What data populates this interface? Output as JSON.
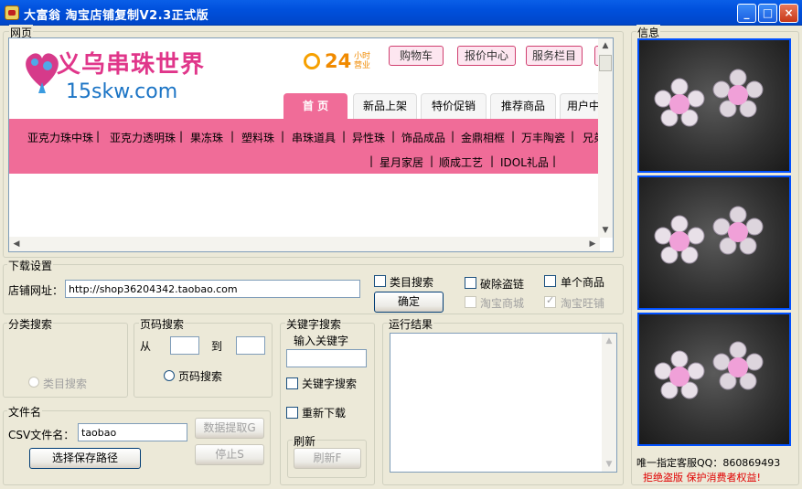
{
  "window": {
    "title": "大富翁 淘宝店铺复制V2.3正式版",
    "min_label": "_",
    "max_label": "□",
    "close_label": "×"
  },
  "webview": {
    "label": "网页",
    "site": {
      "logo_text": "义乌串珠世界",
      "logo_domain": "15skw.com",
      "hours_num": "24",
      "hours_top": "小时",
      "hours_bottom": "营业",
      "nav": [
        "购物车",
        "报价中心",
        "服务栏目"
      ],
      "tabs": [
        "首 页",
        "新品上架",
        "特价促销",
        "推荐商品",
        "用户中"
      ],
      "categories_row1": [
        "亚克力珠中珠",
        "亚克力透明珠",
        "果冻珠",
        "塑料珠",
        "串珠道具",
        "异性珠",
        "饰品成品",
        "金鼎相框",
        "万丰陶瓷",
        "兄弟"
      ],
      "categories_row2": [
        "星月家居",
        "顺成工艺",
        "IDOL礼品"
      ],
      "colors": {
        "pink": "#F06C98",
        "logo_pink": "#E0368A",
        "logo_blue": "#1B74C5"
      }
    }
  },
  "download": {
    "label": "下载设置",
    "store_url_label": "店铺网址：",
    "store_url_value": "http://shop36204342.taobao.com",
    "category_search": "类目搜索",
    "confirm": "确定",
    "break_hotlink": "破除盗链",
    "single_product": "单个商品",
    "taobao_mall": "淘宝商城",
    "taobao_wangpu": "淘宝旺铺"
  },
  "category_search": {
    "label": "分类搜索",
    "radio": "类目搜索"
  },
  "page_search": {
    "label": "页码搜索",
    "from": "从",
    "to": "到",
    "radio": "页码搜索"
  },
  "keyword_search": {
    "label": "关键字搜索",
    "input_label": "输入关键字",
    "checkbox": "关键字搜索",
    "redownload": "重新下载",
    "refresh_label": "刷新",
    "refresh_button": "刷新F"
  },
  "filename": {
    "label": "文件名",
    "csv_label": "CSV文件名：",
    "csv_value": "taobao",
    "extract": "数据提取G",
    "stop": "停止S",
    "choose_path": "选择保存路径"
  },
  "results": {
    "label": "运行结果"
  },
  "info": {
    "label": "信息",
    "qq": "唯一指定客服QQ：860869493",
    "anti_piracy": "拒绝盗版 保护消费者权益!"
  }
}
